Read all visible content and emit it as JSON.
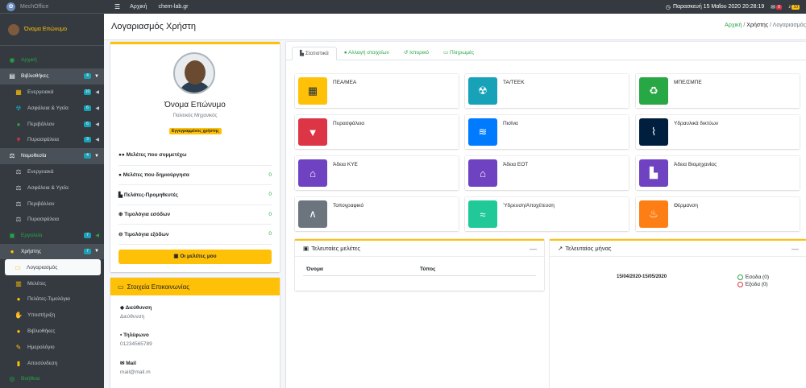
{
  "brand": {
    "name": "MechOffice"
  },
  "user_panel": {
    "name": "Όνομα Επώνυμο"
  },
  "sidebar": {
    "items": [
      {
        "label": "Αρχική",
        "icon": "dashboard-icon"
      },
      {
        "label": "Βιβλιοθήκες",
        "badge": "4"
      },
      {
        "label": "Ενεργειακά",
        "badge": "10"
      },
      {
        "label": "Ασφάλεια & Υγεία",
        "badge": "6"
      },
      {
        "label": "Περιβάλλον",
        "badge": "6"
      },
      {
        "label": "Πυρασφάλεια",
        "badge": "3"
      },
      {
        "label": "Νομοθεσία",
        "badge": "4"
      },
      {
        "label": "Ενεργειακά"
      },
      {
        "label": "Ασφάλεια & Υγεία"
      },
      {
        "label": "Περιβάλλον"
      },
      {
        "label": "Πυρασφάλεια"
      },
      {
        "label": "Εργαλεία",
        "badge": "7"
      },
      {
        "label": "Χρήστης",
        "badge": "7"
      },
      {
        "label": "Λογαριασμός"
      },
      {
        "label": "Μελέτες"
      },
      {
        "label": "Πελάτες-Τιμολόγια"
      },
      {
        "label": "Υποστήριξη"
      },
      {
        "label": "Βιβλιοθήκες"
      },
      {
        "label": "Ημερολόγιο"
      },
      {
        "label": "Αποσύνδεση"
      },
      {
        "label": "Βοήθεια"
      }
    ]
  },
  "topbar": {
    "link_home": "Αρχική",
    "link_site": "chem-lab.gr",
    "clock": "Παρασκευή 15 Μαΐου 2020 20:28:19",
    "messages_badge": "0",
    "notifications_badge": "10"
  },
  "header": {
    "title": "Λογαριασμός Χρήστη",
    "breadcrumb": [
      "Αρχική",
      "Χρήστης",
      "Λογαριασμός"
    ]
  },
  "profile": {
    "name": "Όνομα Επώνυμο",
    "title": "Πολιτικός Μηχανικός",
    "role": "Εγγεγραμμένος χρήστης",
    "stats": [
      {
        "label": "Μελέτες που συμμετέχω",
        "value": ""
      },
      {
        "label": "Μελέτες που δημιούργησα",
        "value": "0"
      },
      {
        "label": "Πελάτες-Προμηθευτές",
        "value": "0"
      },
      {
        "label": "Τιμολόγια εσόδων",
        "value": "0"
      },
      {
        "label": "Τιμολόγια εξόδων",
        "value": "0"
      }
    ],
    "button": "Οι μελέτες μου"
  },
  "contact": {
    "title": "Στοιχεία Επικοινωνίας",
    "fields": [
      {
        "label": "Διεύθυνση",
        "value": "Διεύθυνση"
      },
      {
        "label": "Τηλέφωνο",
        "value": "01234565789"
      },
      {
        "label": "Mail",
        "value": "mail@mail.m"
      }
    ]
  },
  "tabs": [
    {
      "label": "Στατιστικά"
    },
    {
      "label": "Αλλαγή στοιχείων"
    },
    {
      "label": "Ιστορικό"
    },
    {
      "label": "Πληρωμές"
    }
  ],
  "tiles": [
    {
      "label": "ΠΕΑ/ΜΕΑ",
      "color": "#ffc107",
      "icon": "solar-panel-icon"
    },
    {
      "label": "ΤΑ/ΤΕΕΚ",
      "color": "#17a2b8",
      "icon": "radiation-icon"
    },
    {
      "label": "ΜΠΕ/ΣΜΠΕ",
      "color": "#28a745",
      "icon": "recycle-icon"
    },
    {
      "label": "Πυρασφάλεια",
      "color": "#dc3545",
      "icon": "fire-extinguisher-icon"
    },
    {
      "label": "Πισίνα",
      "color": "#007bff",
      "icon": "swimmer-icon"
    },
    {
      "label": "Υδραυλικά δικτύων",
      "color": "#001f3f",
      "icon": "pipe-network-icon"
    },
    {
      "label": "Άδεια ΚΥΕ",
      "color": "#6f42c1",
      "icon": "store-icon"
    },
    {
      "label": "Άδεια ΕΟΤ",
      "color": "#6f42c1",
      "icon": "store-icon"
    },
    {
      "label": "Άδεια Βιομηχανίας",
      "color": "#6f42c1",
      "icon": "industry-icon"
    },
    {
      "label": "Τοπογραφικό",
      "color": "#6c757d",
      "icon": "drafting-compass-icon"
    },
    {
      "label": "Ύδρευση/Αποχέτευση",
      "color": "#20c997",
      "icon": "water-icon"
    },
    {
      "label": "Θέρμανση",
      "color": "#fd7e14",
      "icon": "flame-icon"
    }
  ],
  "recent_studies": {
    "title": "Τελευταίες μελέτες",
    "columns": [
      "Όνομα",
      "Τύπος"
    ]
  },
  "last_month": {
    "title": "Τελευταίος μήνας",
    "range": "15/04/2020-15/05/2020",
    "legend": [
      {
        "label": "Έσοδα (0)",
        "color": "#28a745"
      },
      {
        "label": "Έξοδα (0)",
        "color": "#dc3545"
      }
    ]
  }
}
